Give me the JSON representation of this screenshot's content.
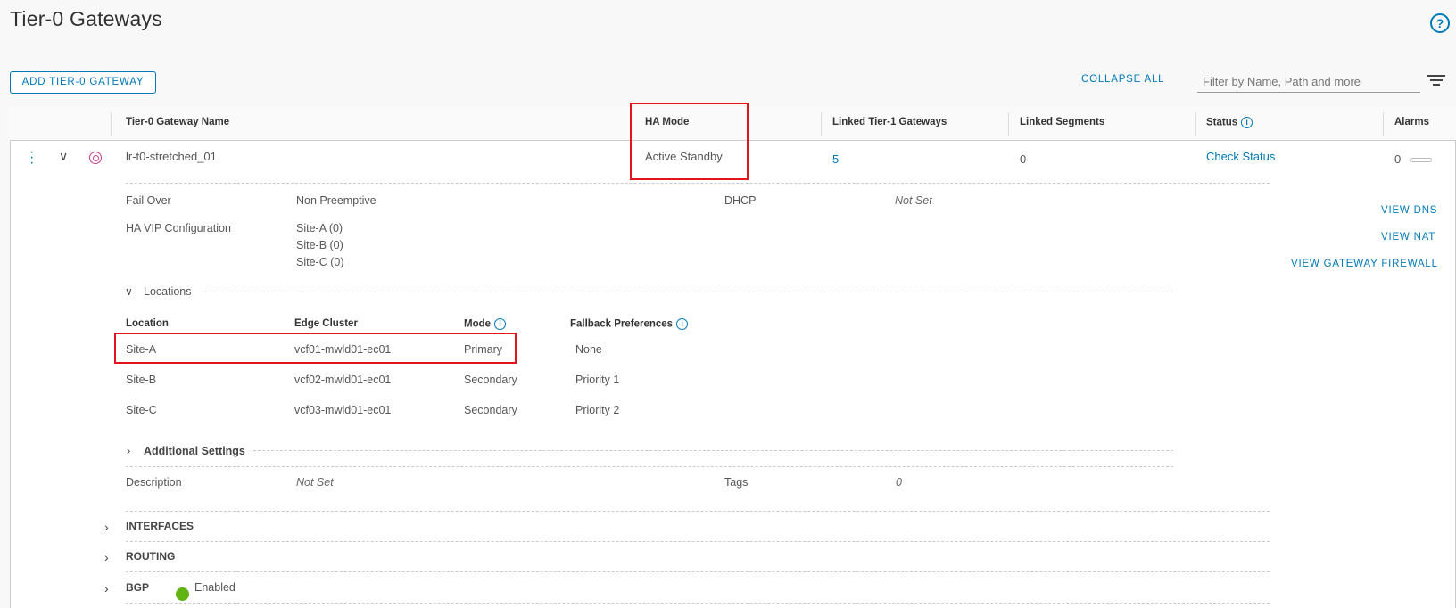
{
  "page": {
    "title": "Tier-0 Gateways",
    "help_icon": "help-icon"
  },
  "toolbar": {
    "add_button": "ADD TIER-0 GATEWAY",
    "collapse_all": "COLLAPSE ALL",
    "filter_placeholder": "Filter by Name, Path and more",
    "filter_icon": "filter-lines-icon"
  },
  "table": {
    "columns": [
      "Tier-0 Gateway Name",
      "HA Mode",
      "Linked Tier-1 Gateways",
      "Linked Segments",
      "Status",
      "Alarms"
    ],
    "row": {
      "name": "lr-t0-stretched_01",
      "ha_mode": "Active Standby",
      "linked_tier1": "5",
      "linked_segments": "0",
      "status": "Check Status",
      "alarms": "0"
    }
  },
  "details": {
    "fail_over_label": "Fail Over",
    "fail_over_value": "Non Preemptive",
    "dhcp_label": "DHCP",
    "dhcp_value": "Not Set",
    "ha_vip_label": "HA VIP Configuration",
    "ha_vip_values": [
      "Site-A (0)",
      "Site-B (0)",
      "Site-C (0)"
    ],
    "side_links": [
      "VIEW DNS",
      "VIEW NAT",
      "VIEW GATEWAY FIREWALL"
    ],
    "locations_title": "Locations",
    "locations_columns": [
      "Location",
      "Edge Cluster",
      "Mode",
      "Fallback Preferences"
    ],
    "locations": [
      {
        "location": "Site-A",
        "edge_cluster": "vcf01-mwld01-ec01",
        "mode": "Primary",
        "fallback": "None"
      },
      {
        "location": "Site-B",
        "edge_cluster": "vcf02-mwld01-ec01",
        "mode": "Secondary",
        "fallback": "Priority 1"
      },
      {
        "location": "Site-C",
        "edge_cluster": "vcf03-mwld01-ec01",
        "mode": "Secondary",
        "fallback": "Priority 2"
      }
    ],
    "additional_settings": "Additional Settings",
    "description_label": "Description",
    "description_value": "Not Set",
    "tags_label": "Tags",
    "tags_value": "0"
  },
  "sections": {
    "interfaces": "INTERFACES",
    "routing": "ROUTING",
    "bgp": "BGP",
    "bgp_status": "Enabled"
  },
  "colors": {
    "accent": "#0079b8",
    "highlight": "#e3141c",
    "enabled": "#60b515"
  }
}
